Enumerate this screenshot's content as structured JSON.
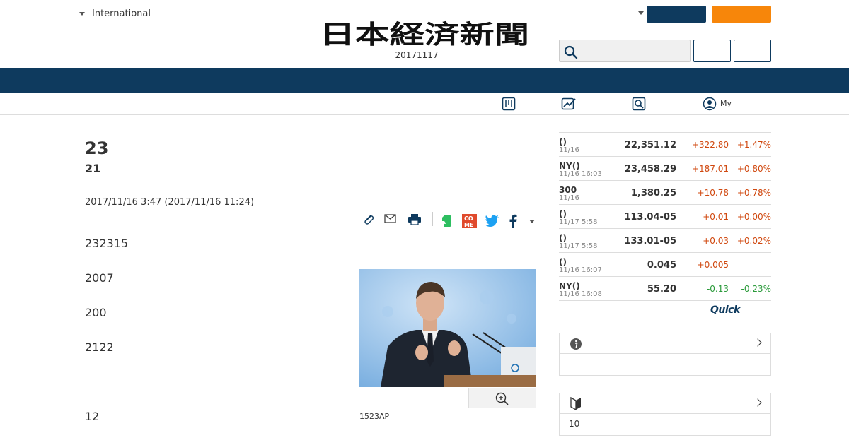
{
  "header": {
    "edition_label": "International",
    "logo_text": "日本経済新聞",
    "issue_date": "20171117",
    "navy_button_label": "",
    "orange_button_label": "",
    "search_placeholder": "",
    "outline_button_1": "",
    "outline_button_2": ""
  },
  "subnav": {
    "my_label": "My",
    "icons": [
      "paper-icon",
      "chart-icon",
      "search-doc-icon",
      "user-icon"
    ]
  },
  "article": {
    "title": "23",
    "subtitle": "21",
    "dateline": "2017/11/16 3:47 (2017/11/16 11:24)",
    "paragraphs": [
      "232315",
      "2007",
      "200",
      "2122",
      "12"
    ],
    "photo_caption": "1523AP"
  },
  "market": {
    "rows": [
      {
        "name": "()",
        "time": "11/16",
        "value": "22,351.12",
        "change": "+322.80",
        "pct": "+1.47%",
        "dir": "up"
      },
      {
        "name": "NY()",
        "time": "11/16 16:03",
        "value": "23,458.29",
        "change": "+187.01",
        "pct": "+0.80%",
        "dir": "up"
      },
      {
        "name": "300",
        "time": "11/16",
        "value": "1,380.25",
        "change": "+10.78",
        "pct": "+0.78%",
        "dir": "up"
      },
      {
        "name": "()",
        "time": "11/17 5:58",
        "value": "113.04-05",
        "change": "+0.01",
        "pct": "+0.00%",
        "dir": "up"
      },
      {
        "name": "()",
        "time": "11/17 5:58",
        "value": "133.01-05",
        "change": "+0.03",
        "pct": "+0.02%",
        "dir": "up"
      },
      {
        "name": "()",
        "time": "11/16 16:07",
        "value": "0.045",
        "change": "+0.005",
        "pct": "",
        "dir": "up"
      },
      {
        "name": "NY()",
        "time": "11/16 16:08",
        "value": "55.20",
        "change": "-0.13",
        "pct": "-0.23%",
        "dir": "down"
      }
    ],
    "provider": "Quick"
  },
  "boxes": {
    "info_body": "",
    "beginner_body": "10"
  },
  "colors": {
    "navy": "#0e3a5e",
    "orange": "#f7860a",
    "up": "#d0480f",
    "down": "#2a9a3a"
  }
}
